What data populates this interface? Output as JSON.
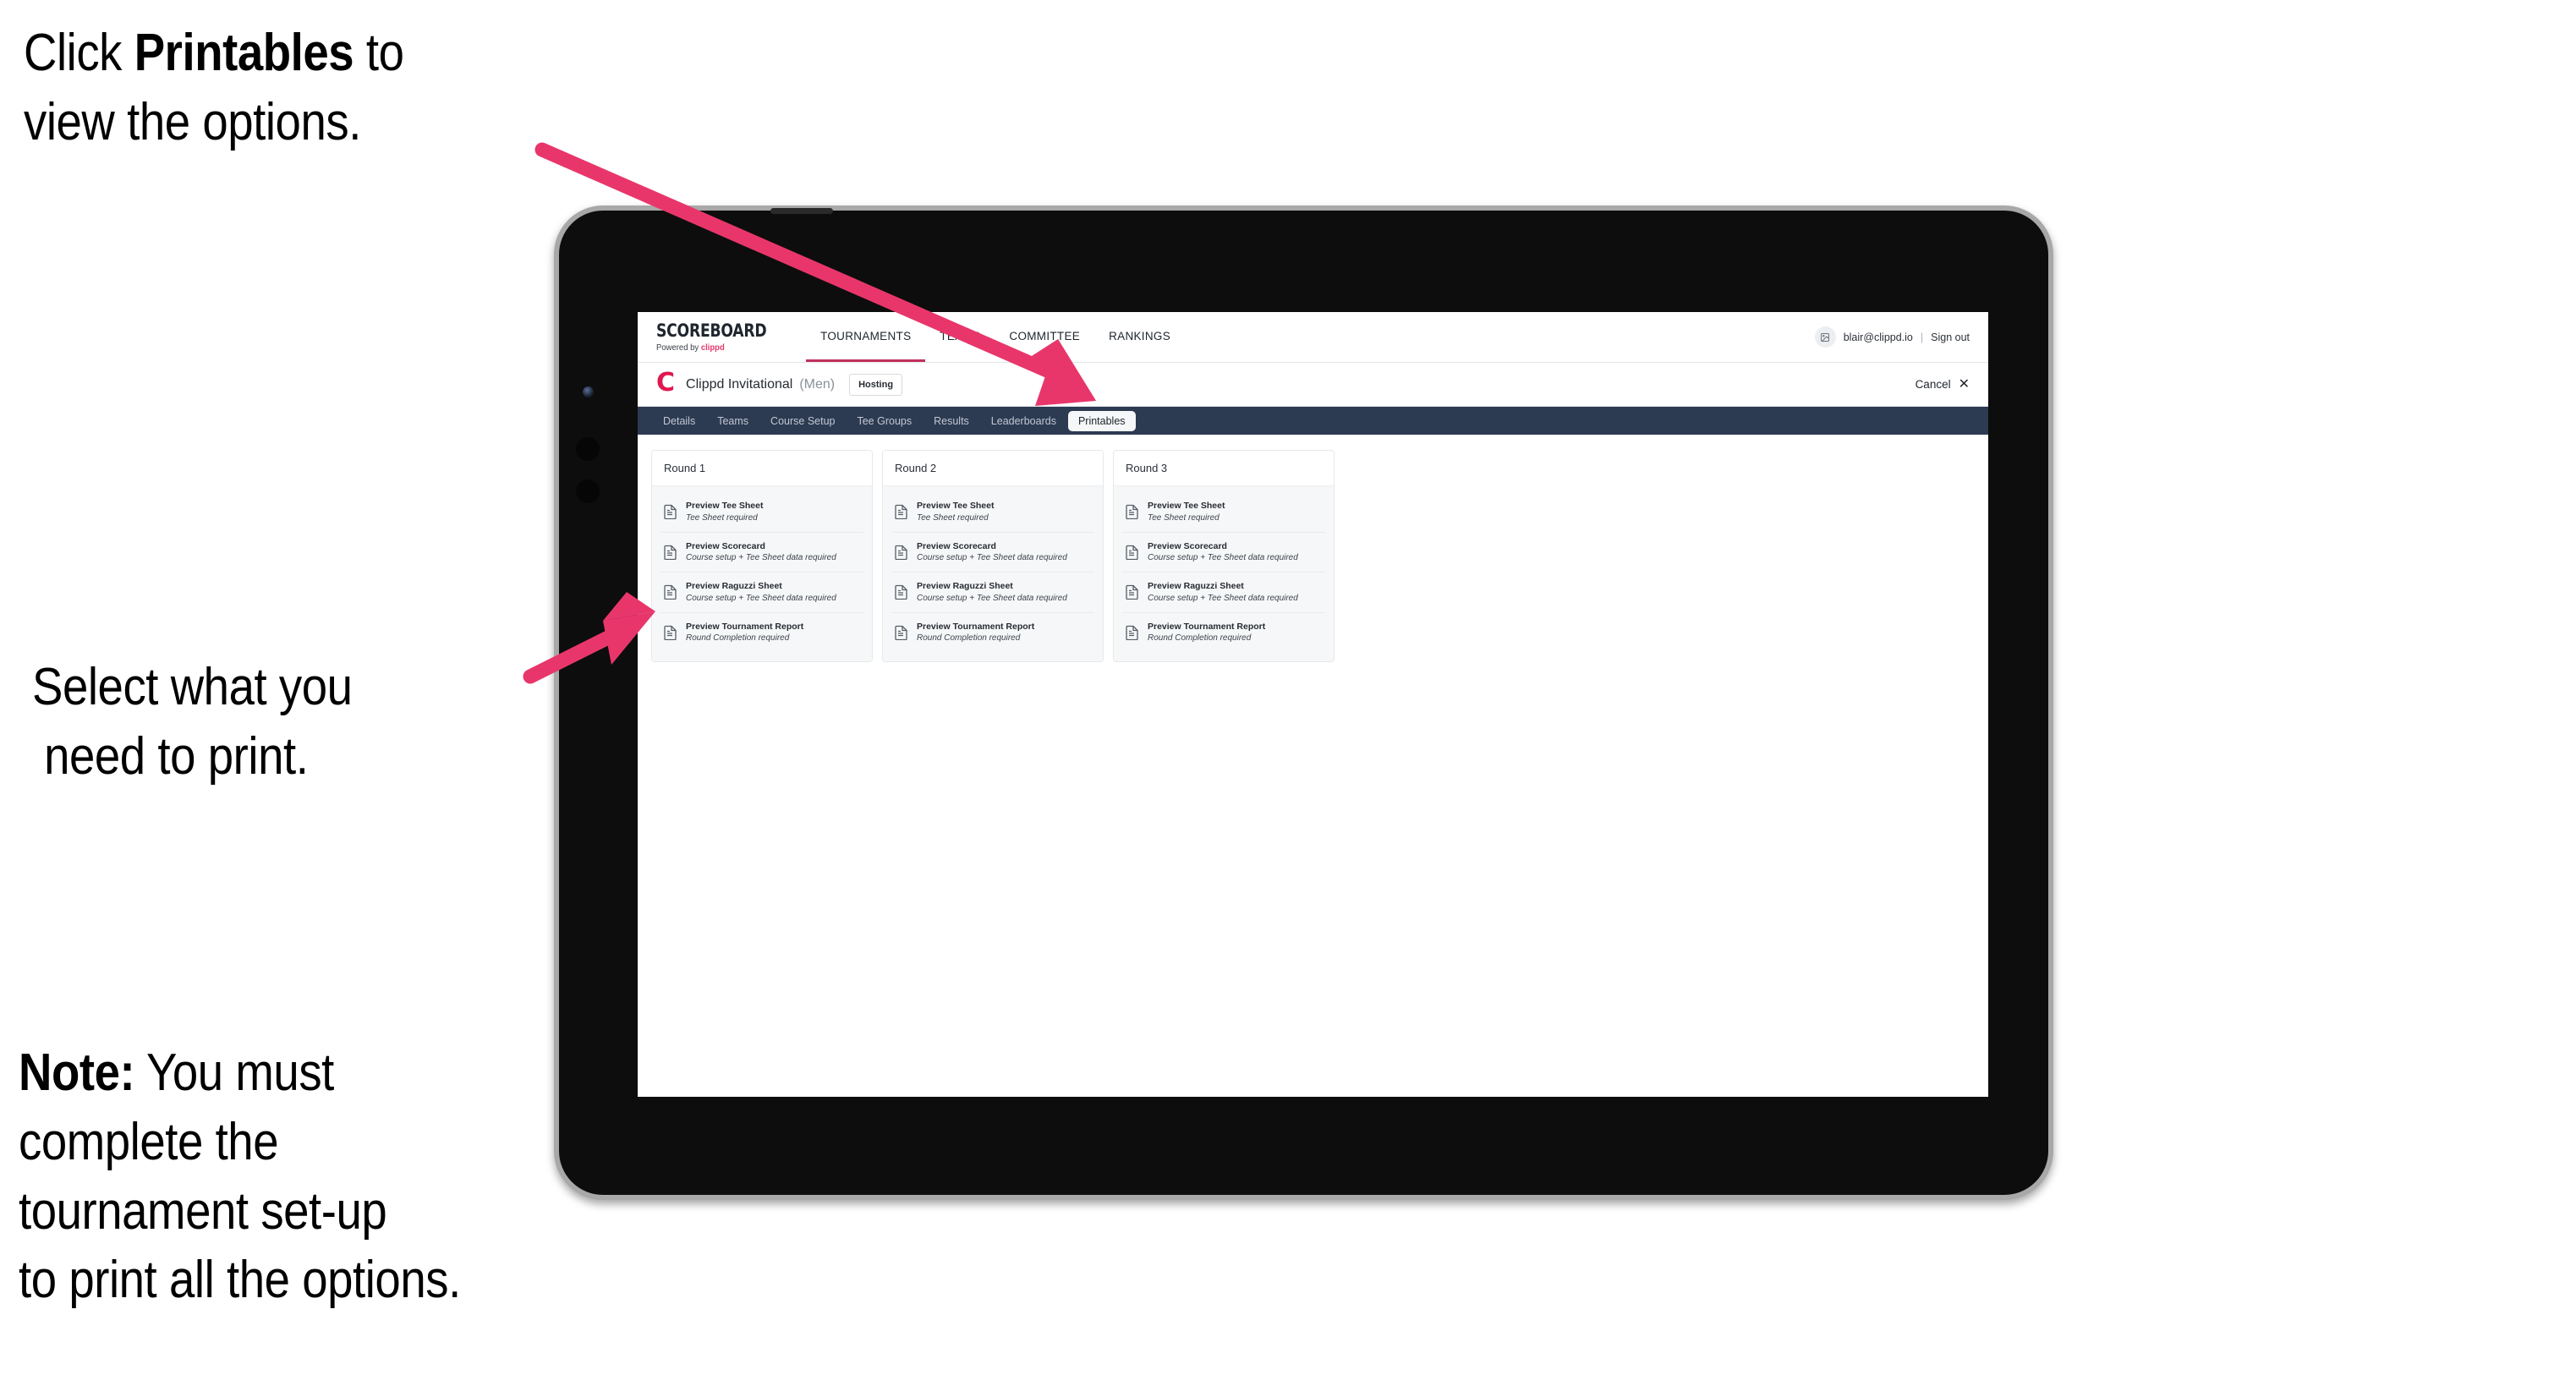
{
  "annotations": {
    "click": {
      "pre": "Click ",
      "bold": "Printables",
      "post": " to",
      "line2": "view the options."
    },
    "select": {
      "line1": "Select what you",
      "line2": "need to print."
    },
    "note": {
      "bold": "Note:",
      "line1": " You must",
      "line2": "complete the",
      "line3": "tournament set-up",
      "line4": "to print all the options."
    }
  },
  "colors": {
    "arrow_pink": "#E8366B",
    "brand_pink": "#E8366B",
    "tabbar_dark": "#2C3A52",
    "accent_crimson": "#C0315C"
  },
  "app": {
    "brand": {
      "title": "SCOREBOARD",
      "powered_prefix": "Powered by ",
      "powered_brand": "clippd"
    },
    "topnav": [
      {
        "label": "TOURNAMENTS",
        "active": true
      },
      {
        "label": "TEAMS",
        "active": false
      },
      {
        "label": "COMMITTEE",
        "active": false
      },
      {
        "label": "RANKINGS",
        "active": false
      }
    ],
    "account": {
      "avatar_icon": "user-image-icon",
      "email": "blair@clippd.io",
      "separator": "|",
      "sign_out": "Sign out"
    },
    "tournament": {
      "logo_letter": "C",
      "name": "Clippd Invitational",
      "gender": "(Men)",
      "badge": "Hosting",
      "cancel_label": "Cancel",
      "cancel_icon": "✕"
    },
    "tabs": [
      {
        "label": "Details",
        "active": false
      },
      {
        "label": "Teams",
        "active": false
      },
      {
        "label": "Course Setup",
        "active": false
      },
      {
        "label": "Tee Groups",
        "active": false
      },
      {
        "label": "Results",
        "active": false
      },
      {
        "label": "Leaderboards",
        "active": false
      },
      {
        "label": "Printables",
        "active": true
      }
    ],
    "rounds": [
      {
        "title": "Round 1",
        "items": [
          {
            "title": "Preview Tee Sheet",
            "sub": "Tee Sheet required"
          },
          {
            "title": "Preview Scorecard",
            "sub": "Course setup + Tee Sheet data required"
          },
          {
            "title": "Preview Raguzzi Sheet",
            "sub": "Course setup + Tee Sheet data required"
          },
          {
            "title": "Preview Tournament Report",
            "sub": "Round Completion required"
          }
        ]
      },
      {
        "title": "Round 2",
        "items": [
          {
            "title": "Preview Tee Sheet",
            "sub": "Tee Sheet required"
          },
          {
            "title": "Preview Scorecard",
            "sub": "Course setup + Tee Sheet data required"
          },
          {
            "title": "Preview Raguzzi Sheet",
            "sub": "Course setup + Tee Sheet data required"
          },
          {
            "title": "Preview Tournament Report",
            "sub": "Round Completion required"
          }
        ]
      },
      {
        "title": "Round 3",
        "items": [
          {
            "title": "Preview Tee Sheet",
            "sub": "Tee Sheet required"
          },
          {
            "title": "Preview Scorecard",
            "sub": "Course setup + Tee Sheet data required"
          },
          {
            "title": "Preview Raguzzi Sheet",
            "sub": "Course setup + Tee Sheet data required"
          },
          {
            "title": "Preview Tournament Report",
            "sub": "Round Completion required"
          }
        ]
      }
    ]
  }
}
